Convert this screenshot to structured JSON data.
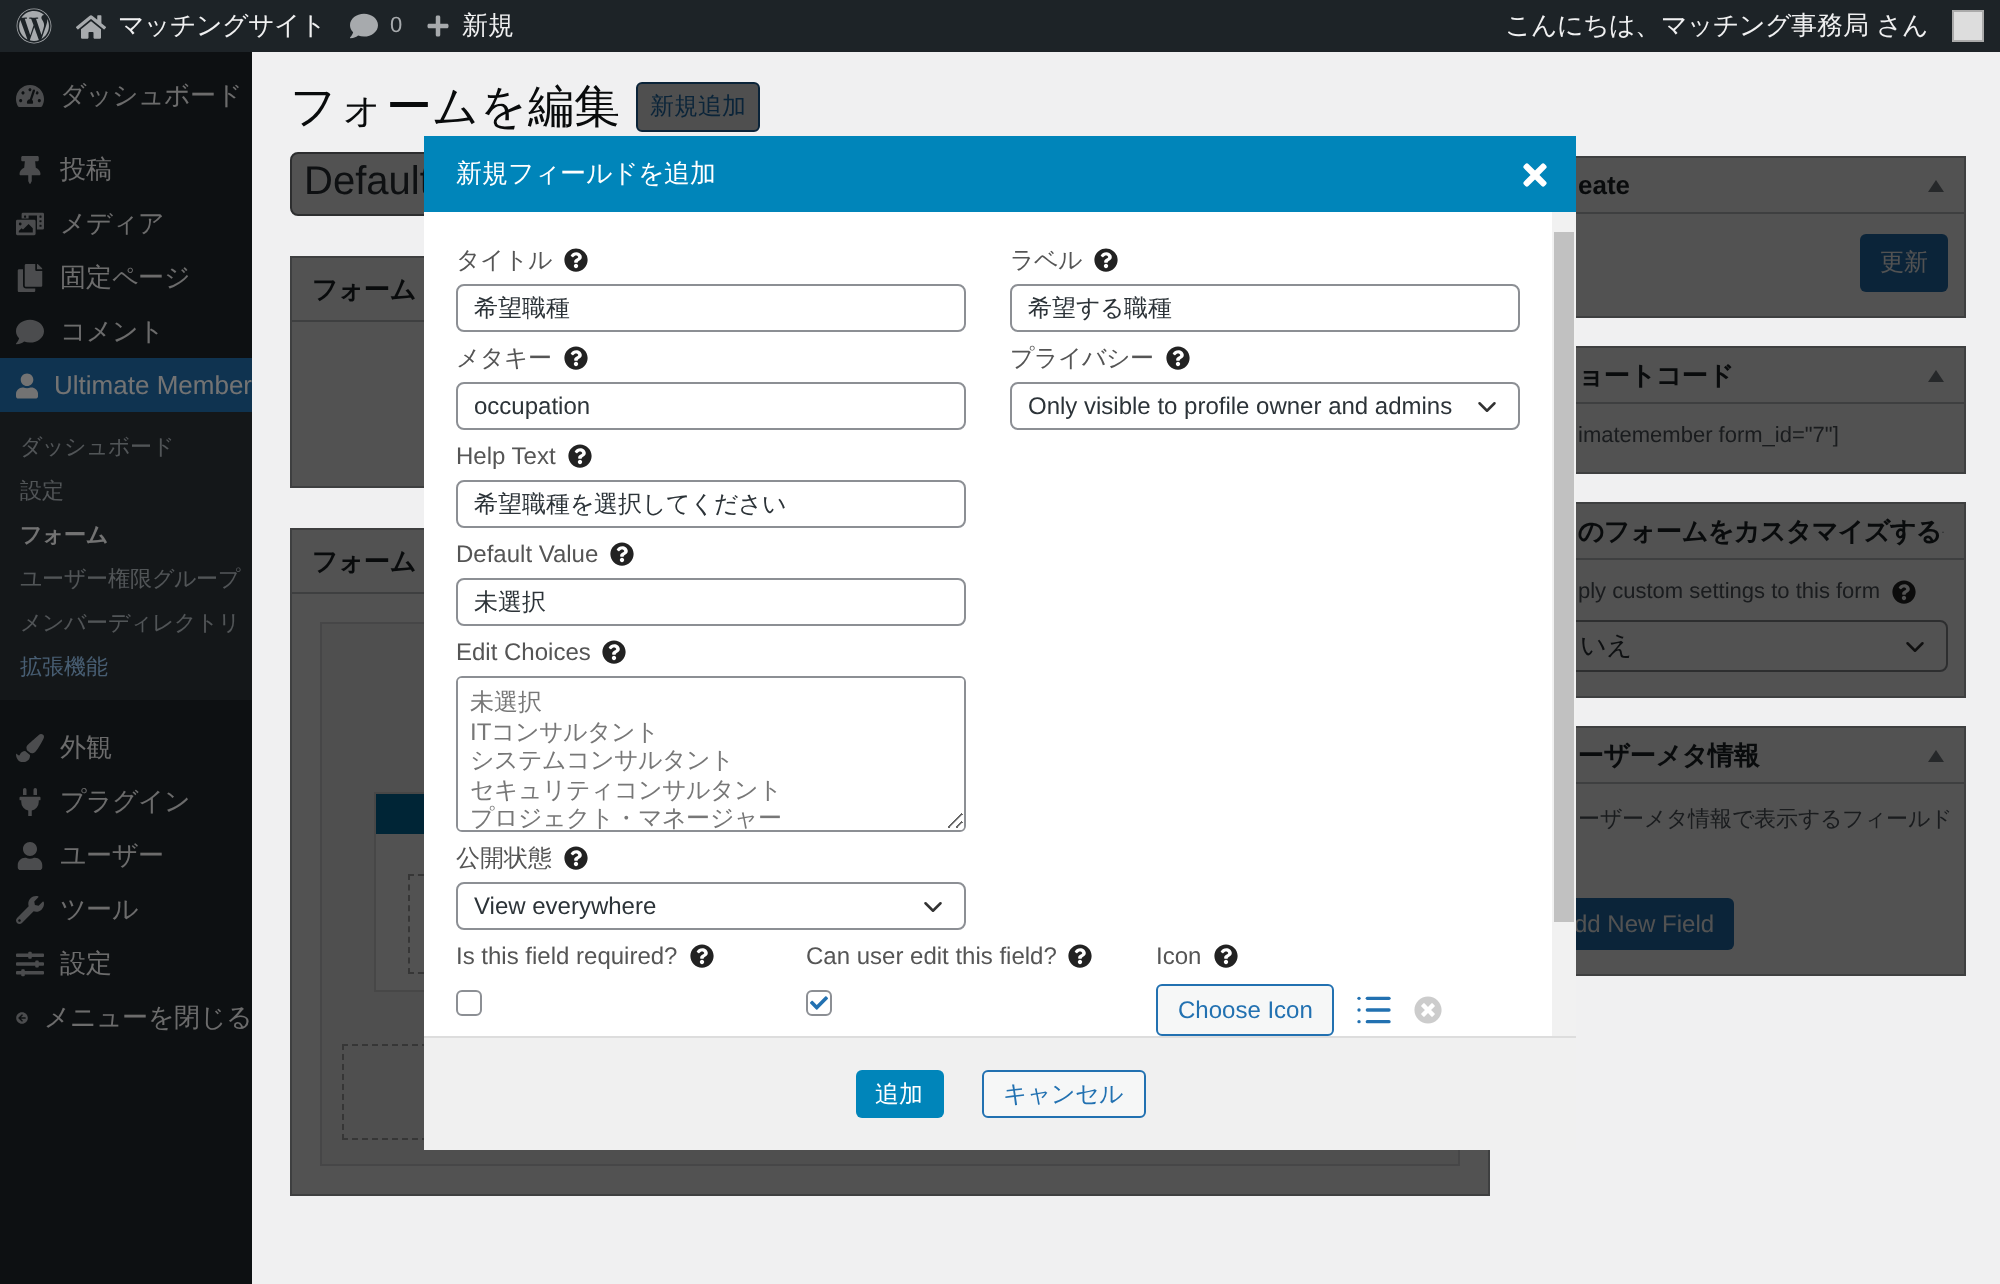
{
  "admin_bar": {
    "site_name": "マッチングサイト",
    "comments_count": "0",
    "new_label": "新規",
    "greeting": "こんにちは、マッチング事務局 さん"
  },
  "sidebar": {
    "groups": [
      {
        "items": [
          {
            "label": "ダッシュボード",
            "selected": false
          }
        ]
      },
      {
        "items": [
          {
            "label": "投稿",
            "selected": false
          },
          {
            "label": "メディア",
            "selected": false
          },
          {
            "label": "固定ページ",
            "selected": false
          },
          {
            "label": "コメント",
            "selected": false
          },
          {
            "label": "Ultimate Member",
            "selected": true,
            "children": [
              {
                "label": "ダッシュボード",
                "selected": false,
                "kind": "normal"
              },
              {
                "label": "設定",
                "selected": false,
                "kind": "normal"
              },
              {
                "label": "フォーム",
                "selected": true,
                "kind": "normal"
              },
              {
                "label": "ユーザー権限グループ",
                "selected": false,
                "kind": "normal"
              },
              {
                "label": "メンバーディレクトリ",
                "selected": false,
                "kind": "normal"
              },
              {
                "label": "拡張機能",
                "selected": false,
                "kind": "highlight"
              }
            ]
          }
        ]
      },
      {
        "items": [
          {
            "label": "外観",
            "selected": false
          },
          {
            "label": "プラグイン",
            "selected": false
          },
          {
            "label": "ユーザー",
            "selected": false
          },
          {
            "label": "ツール",
            "selected": false
          },
          {
            "label": "設定",
            "selected": false
          },
          {
            "label": "メニューを閉じる",
            "selected": false
          }
        ]
      }
    ]
  },
  "page": {
    "title": "フォームを編集",
    "add_new_button": "新規追加",
    "form_title_value": "Default",
    "panels": [
      {
        "title": "フォーム",
        "kind": "plain"
      },
      {
        "title": "フォーム",
        "kind": "builder"
      }
    ]
  },
  "right_boxes": [
    {
      "kind": "publish",
      "title": "eate",
      "button": "更新"
    },
    {
      "kind": "shortcode",
      "title": "ョートコード",
      "text": "imatemember form_id=\"7\"]"
    },
    {
      "kind": "customize",
      "title": "のフォームをカスタマイズする",
      "label": "ply custom settings to this form",
      "select_value": "いえ"
    },
    {
      "kind": "meta",
      "title": "ーザーメタ情報",
      "text": "ーザーメタ情報で表示するフィールド",
      "button": "dd New Field"
    }
  ],
  "modal": {
    "title": "新規フィールドを追加",
    "left_fields": [
      {
        "kind": "text",
        "label": "タイトル",
        "value": "希望職種"
      },
      {
        "kind": "text",
        "label": "メタキー",
        "value": "occupation"
      },
      {
        "kind": "text",
        "label": "Help Text",
        "value": "希望職種を選択してください"
      },
      {
        "kind": "text",
        "label": "Default Value",
        "value": "未選択"
      },
      {
        "kind": "textarea",
        "label": "Edit Choices",
        "lines": [
          "未選択",
          "ITコンサルタント",
          "システムコンサルタント",
          "セキュリティコンサルタント",
          "プロジェクト・マネージャー"
        ]
      },
      {
        "kind": "select",
        "label": "公開状態",
        "value": "View everywhere"
      }
    ],
    "right_fields": [
      {
        "kind": "text",
        "label": "ラベル",
        "value": "希望する職種"
      },
      {
        "kind": "select",
        "label": "プライバシー",
        "value": "Only visible to profile owner and admins"
      }
    ],
    "checks": [
      {
        "label": "Is this field required?",
        "checked": false
      },
      {
        "label": "Can user edit this field?",
        "checked": true
      }
    ],
    "icon_field": {
      "label": "Icon",
      "button": "Choose Icon"
    },
    "buttons": [
      {
        "label": "追加",
        "kind": "primary"
      },
      {
        "label": "キャンセル",
        "kind": "secondary"
      }
    ]
  }
}
